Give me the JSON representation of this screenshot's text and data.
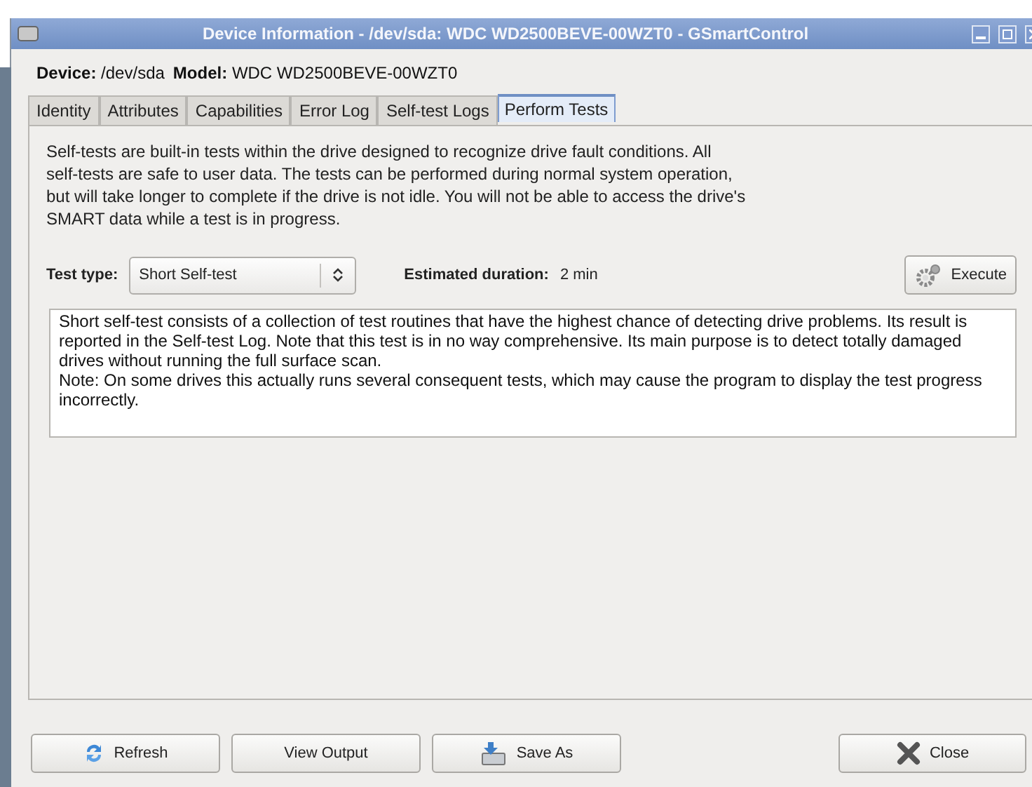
{
  "window": {
    "title": "Device Information - /dev/sda: WDC WD2500BEVE-00WZT0 - GSmartControl"
  },
  "device_info": {
    "device_label": "Device:",
    "device": "/dev/sda",
    "model_label": "Model:",
    "model": "WDC WD2500BEVE-00WZT0"
  },
  "tabs": [
    {
      "label": "Identity",
      "selected": false
    },
    {
      "label": "Attributes",
      "selected": false
    },
    {
      "label": "Capabilities",
      "selected": false
    },
    {
      "label": "Error Log",
      "selected": false
    },
    {
      "label": "Self-test Logs",
      "selected": false
    },
    {
      "label": "Perform Tests",
      "selected": true
    }
  ],
  "intro": "Self-tests are built-in tests within the drive designed to recognize drive fault conditions. All self-tests are safe to user data. The tests can be performed during normal system operation, but will take longer to complete if the drive is not idle. You will not be able to access the drive's SMART data while a test is in progress.",
  "test_type": {
    "label": "Test type:",
    "value": "Short Self-test"
  },
  "duration": {
    "label": "Estimated duration:",
    "value": "2 min"
  },
  "execute_button": {
    "label": "Execute"
  },
  "test_description": [
    "Short self-test consists of a collection of test routines that have the highest chance of detecting drive problems. Its result is reported in the Self-test Log. Note that this test is in no way comprehensive. Its main purpose is to detect totally damaged drives without running the full surface scan.",
    "Note: On some drives this actually runs several consequent tests, which may cause the program to display the test progress incorrectly."
  ],
  "buttons": [
    {
      "kind": "refresh",
      "label": "Refresh"
    },
    {
      "kind": "plain",
      "label": "View Output"
    },
    {
      "kind": "save",
      "label": "Save As"
    },
    {
      "kind": "close",
      "label": "Close"
    }
  ]
}
